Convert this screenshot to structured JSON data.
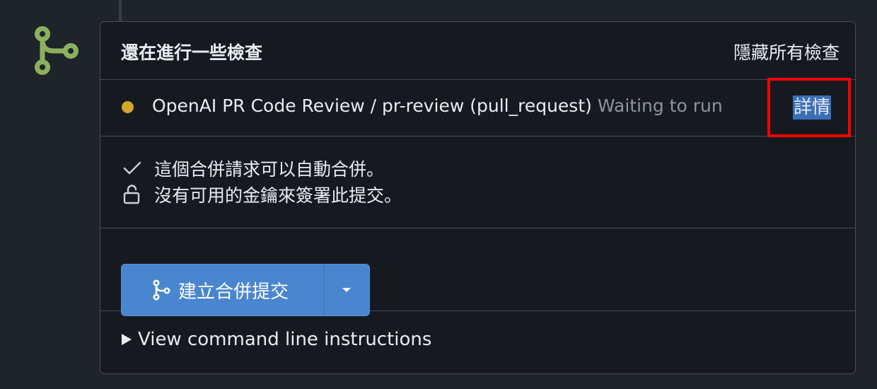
{
  "header": {
    "title": "還在進行一些檢查",
    "hide_all_label": "隱藏所有檢查"
  },
  "check": {
    "status_color": "#d4a72c",
    "name": "OpenAI PR Code Review / pr-review (pull_request)",
    "state": "Waiting to run",
    "details_label": "詳情"
  },
  "merge_status": {
    "auto_merge_text": "這個合併請求可以自動合併。",
    "signing_text": "沒有可用的金鑰來簽署此提交。",
    "check_icon": "check-icon",
    "unlock_icon": "unlock-icon"
  },
  "merge": {
    "button_label": "建立合併提交",
    "button_color": "#4a86cf",
    "icon": "git-merge-icon",
    "dropdown_icon": "caret-down-icon"
  },
  "cli": {
    "label": "View command line instructions",
    "icon": "triangle-right-icon"
  },
  "colors": {
    "badge_green": "#8ab060",
    "background": "#1f232a",
    "panel": "#161a20",
    "border": "#444c56",
    "muted_text": "#8b949e",
    "annotation_red": "#ff0000"
  }
}
